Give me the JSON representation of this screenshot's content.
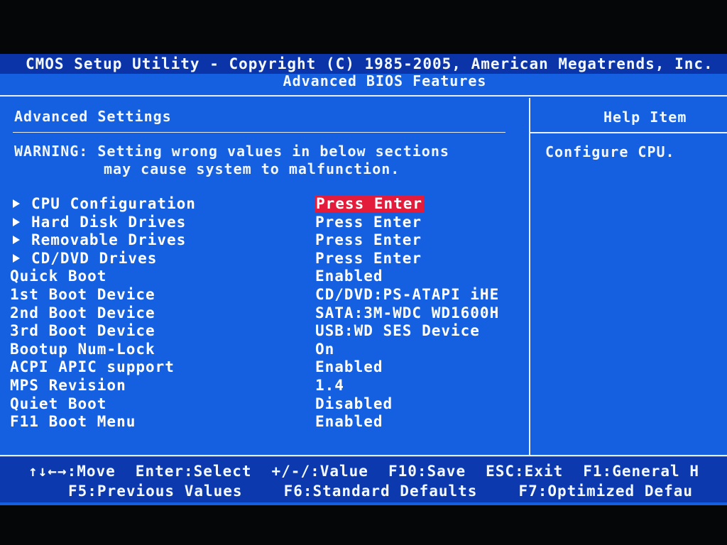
{
  "header": {
    "title": "CMOS Setup Utility - Copyright (C) 1985-2005, American Megatrends, Inc.",
    "subtitle": "Advanced BIOS Features"
  },
  "main": {
    "section_title": "Advanced Settings",
    "warning_line1": "WARNING: Setting wrong values in below sections",
    "warning_line2": "may cause system to malfunction.",
    "items": [
      {
        "label": "CPU Configuration",
        "value": "Press Enter",
        "submenu": true,
        "selected": true
      },
      {
        "label": "Hard Disk Drives",
        "value": "Press Enter",
        "submenu": true
      },
      {
        "label": "Removable Drives",
        "value": "Press Enter",
        "submenu": true
      },
      {
        "label": "CD/DVD Drives",
        "value": "Press Enter",
        "submenu": true
      },
      {
        "label": "Quick Boot",
        "value": "Enabled"
      },
      {
        "label": "1st Boot Device",
        "value": "CD/DVD:PS-ATAPI iHE"
      },
      {
        "label": "2nd Boot Device",
        "value": "SATA:3M-WDC WD1600H"
      },
      {
        "label": "3rd Boot Device",
        "value": "USB:WD SES Device"
      },
      {
        "label": "Bootup Num-Lock",
        "value": "On"
      },
      {
        "label": "ACPI APIC support",
        "value": "Enabled"
      },
      {
        "label": "MPS Revision",
        "value": "1.4"
      },
      {
        "label": "Quiet Boot",
        "value": "Disabled"
      },
      {
        "label": "F11 Boot Menu",
        "value": "Enabled"
      }
    ]
  },
  "help": {
    "title": "Help Item",
    "text": "Configure CPU."
  },
  "footer": {
    "row1": [
      "↑↓←→:Move",
      "Enter:Select",
      "+/-/:Value",
      "F10:Save",
      "ESC:Exit",
      "F1:General H"
    ],
    "row2": [
      "F5:Previous Values",
      "F6:Standard Defaults",
      "F7:Optimized Defau"
    ]
  },
  "colors": {
    "background": "#1560e0",
    "title_bar": "#0a34a8",
    "selection": "#e41c3c",
    "text": "#ffffff"
  }
}
